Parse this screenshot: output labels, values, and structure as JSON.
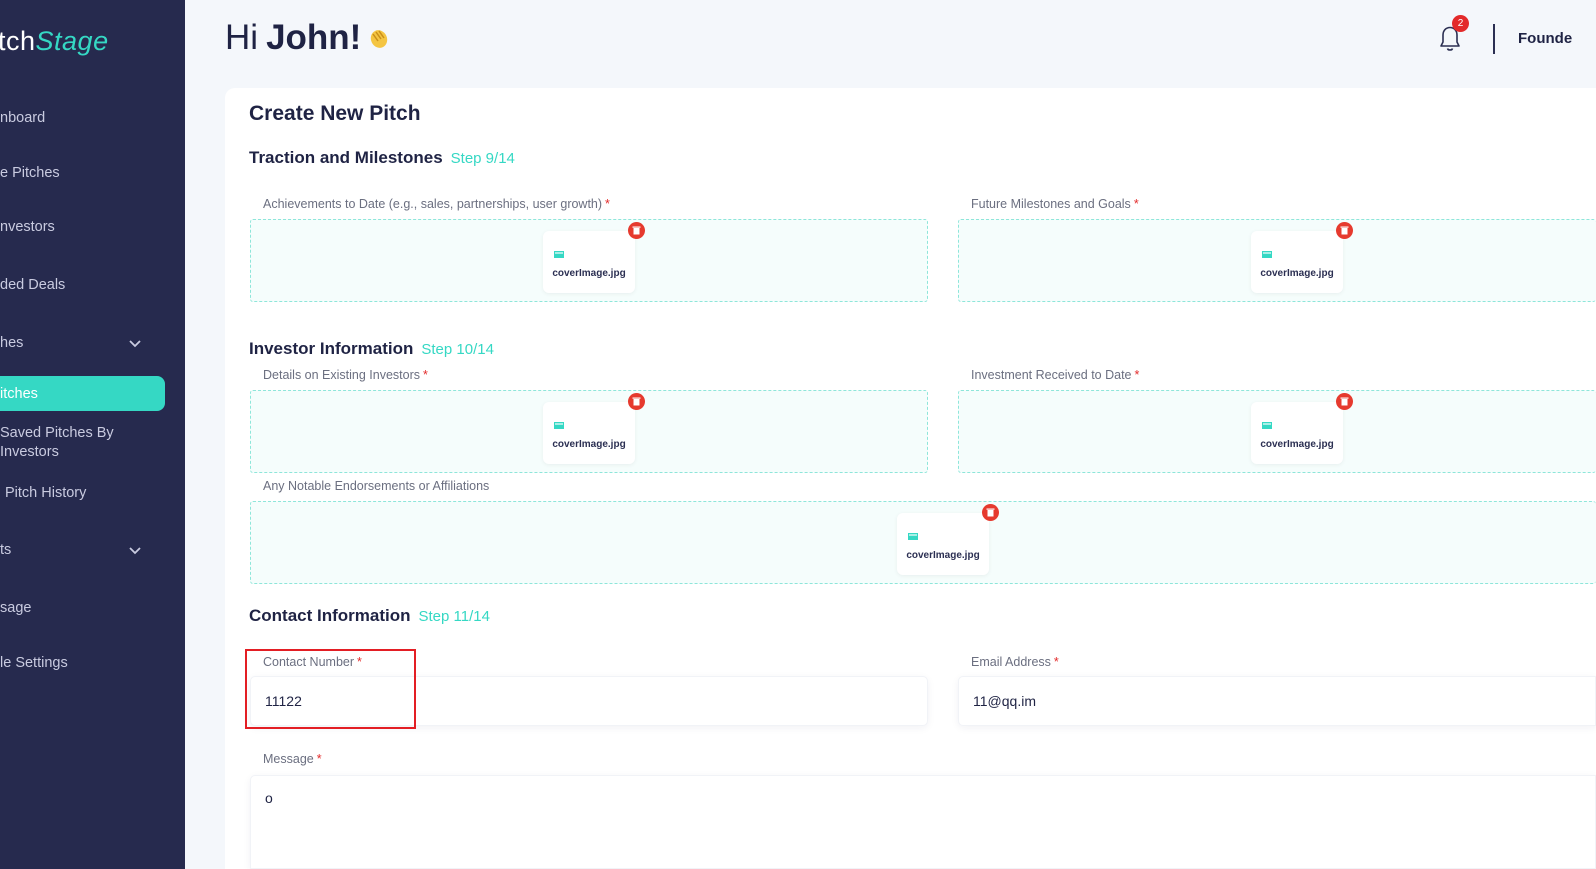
{
  "brand": {
    "name_main": "tch",
    "name_accent": "Stage"
  },
  "sidebar": {
    "items": [
      {
        "label": "nboard"
      },
      {
        "label": "e Pitches"
      },
      {
        "label": "nvestors"
      },
      {
        "label": "ded Deals"
      },
      {
        "label": "hes"
      },
      {
        "label": "itches"
      },
      {
        "label": "Saved Pitches By Investors"
      },
      {
        "label": "Pitch History"
      },
      {
        "label": "ts"
      },
      {
        "label": "sage"
      },
      {
        "label": "le Settings"
      }
    ]
  },
  "header": {
    "greeting": "Hi",
    "name": "John!",
    "notification_count": "2",
    "role": "Founde"
  },
  "form": {
    "title": "Create New Pitch",
    "sections": {
      "traction": {
        "title": "Traction and Milestones",
        "step": "Step 9/14"
      },
      "investor": {
        "title": "Investor Information",
        "step": "Step 10/14"
      },
      "contact": {
        "title": "Contact Information",
        "step": "Step 11/14"
      }
    },
    "fields": {
      "achievements": {
        "label": "Achievements to Date (e.g., sales, partnerships, user growth)",
        "required": "*",
        "file": "coverImage.jpg"
      },
      "future_milestones": {
        "label": "Future Milestones and Goals",
        "required": "*",
        "file": "coverImage.jpg"
      },
      "existing_investors": {
        "label": "Details on Existing Investors",
        "required": "*",
        "file": "coverImage.jpg"
      },
      "investment_received": {
        "label": "Investment Received to Date",
        "required": "*",
        "file": "coverImage.jpg"
      },
      "endorsements": {
        "label": "Any Notable Endorsements or Affiliations",
        "file": "coverImage.jpg"
      },
      "contact_number": {
        "label": "Contact Number",
        "required": "*",
        "value": "11122"
      },
      "email": {
        "label": "Email Address",
        "required": "*",
        "value": "11@qq.im"
      },
      "message": {
        "label": "Message",
        "required": "*",
        "value": "o"
      }
    }
  },
  "colors": {
    "accent": "#35d8c4",
    "sidebar_bg": "#262a4e",
    "danger": "#e32a2a",
    "highlight": "#e31e24"
  }
}
